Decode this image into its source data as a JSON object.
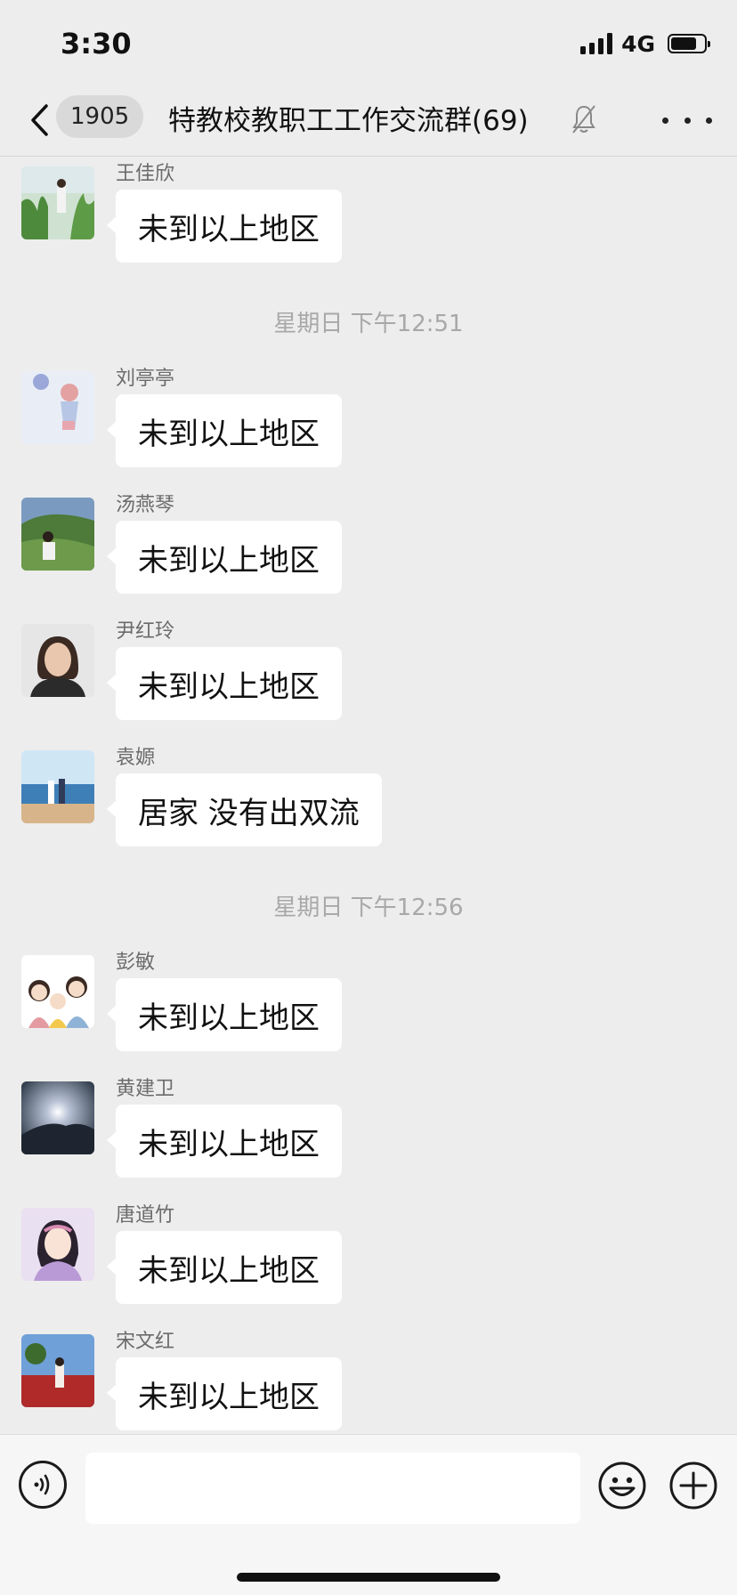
{
  "status_bar": {
    "time": "3:30",
    "network": "4G",
    "icons": [
      "signal-icon",
      "battery-icon"
    ]
  },
  "nav": {
    "back_icon": "chevron-left-icon",
    "unread_count": "1905",
    "title": "特教校教职工工作交流群(69)",
    "mute_icon": "bell-slash-icon",
    "more_icon": "ellipsis-icon"
  },
  "chat": {
    "messages": [
      {
        "sender": "王佳欣",
        "text": "未到以上地区"
      },
      {
        "timestamp": "星期日 下午12:51"
      },
      {
        "sender": "刘亭亭",
        "text": "未到以上地区"
      },
      {
        "sender": "汤燕琴",
        "text": "未到以上地区"
      },
      {
        "sender": "尹红玲",
        "text": "未到以上地区"
      },
      {
        "sender": "袁嫄",
        "text": "居家 没有出双流"
      },
      {
        "timestamp": "星期日 下午12:56"
      },
      {
        "sender": "彭敏",
        "text": "未到以上地区"
      },
      {
        "sender": "黄建卫",
        "text": "未到以上地区"
      },
      {
        "sender": "唐道竹",
        "text": "未到以上地区"
      },
      {
        "sender": "宋文红",
        "text": "未到以上地区"
      }
    ]
  },
  "input_bar": {
    "voice_icon": "voice-icon",
    "text_value": "",
    "emoji_icon": "emoji-icon",
    "plus_icon": "plus-icon"
  },
  "colors": {
    "background": "#ededed",
    "bubble": "#ffffff",
    "timestamp_text": "#a8a8a8",
    "sender_text": "#6b6b6b"
  }
}
